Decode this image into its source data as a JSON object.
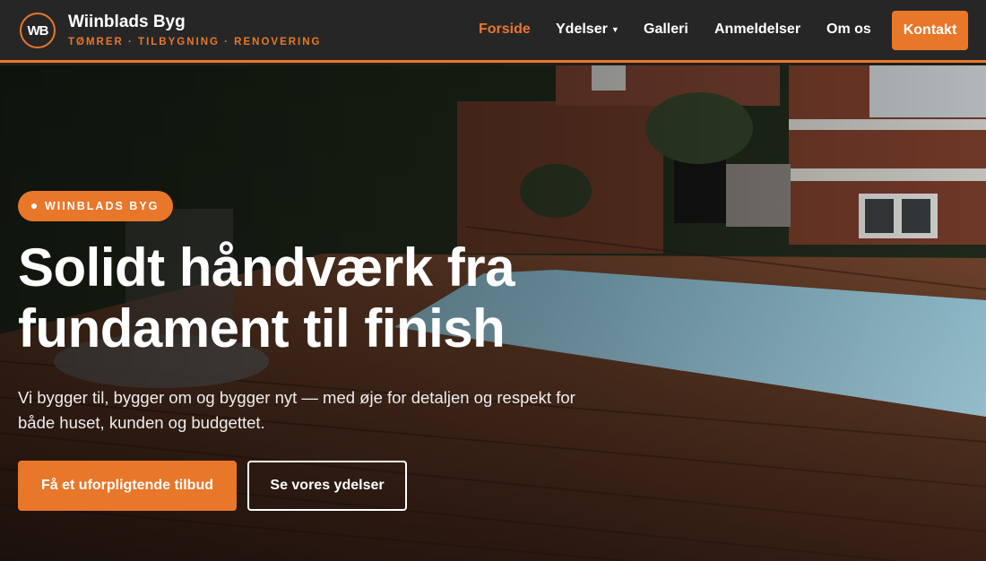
{
  "header": {
    "logo_mark": "WB",
    "brand_name": "Wiinblads Byg",
    "brand_tagline": "TØMRER · TILBYGNING · RENOVERING",
    "nav": [
      {
        "label": "Forside",
        "active": true
      },
      {
        "label": "Ydelser",
        "dropdown": true,
        "caret": "▼"
      },
      {
        "label": "Galleri"
      },
      {
        "label": "Anmeldelser"
      },
      {
        "label": "Om os"
      }
    ],
    "cta_label": "Kontakt"
  },
  "hero": {
    "badge": "WIINBLADS BYG",
    "headline": "Solidt håndværk fra fundament til finish",
    "subtext": "Vi bygger til, bygger om og bygger nyt — med øje for detaljen og respekt for både huset, kunden og budgettet.",
    "primary_button": "Få et uforpligtende tilbud",
    "secondary_button": "Se vores ydelser",
    "background_image": "garden-terrace-pool-deck"
  },
  "colors": {
    "accent": "#e8772a",
    "header_bg": "#262626",
    "text_light": "#ffffff"
  }
}
